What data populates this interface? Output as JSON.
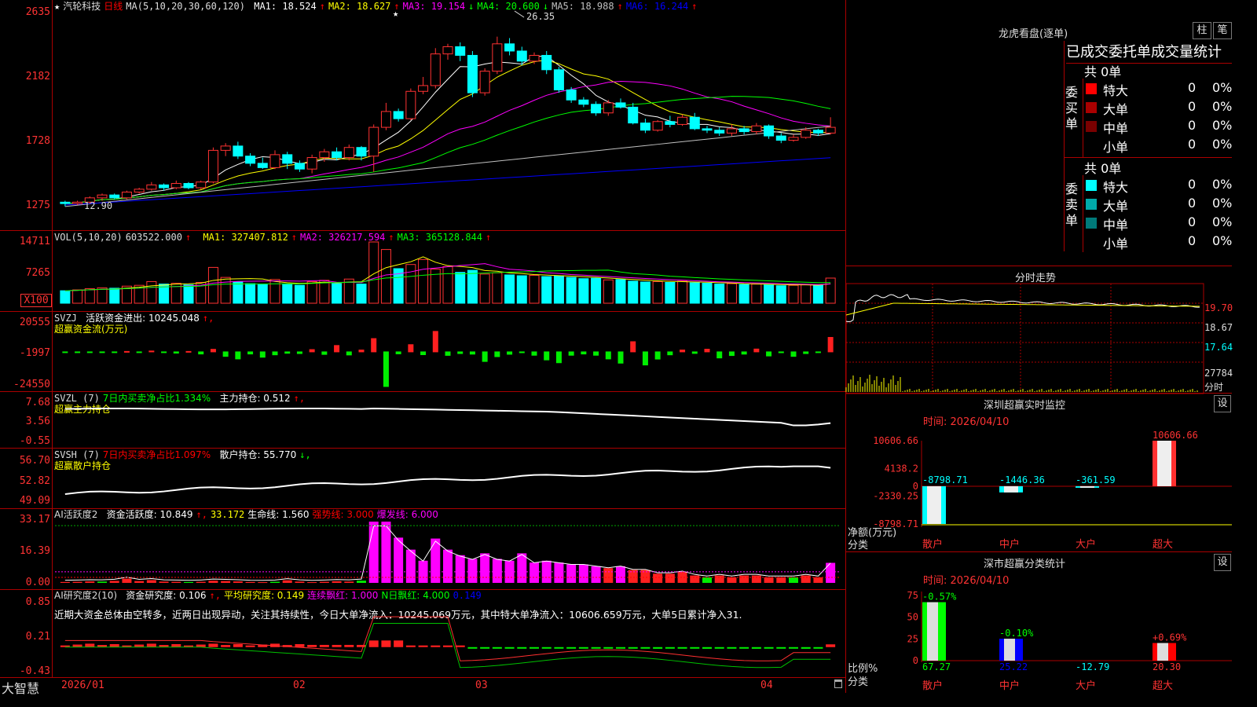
{
  "stock": {
    "star": "★",
    "name": "汽轮科技",
    "period": "日线"
  },
  "main": {
    "ma_header": "MA(5,10,20,30,60,120)",
    "ma_values": [
      {
        "label": "MA1: 18.524",
        "arrow": "↑",
        "color": "#ffffff"
      },
      {
        "label": "MA2: 18.627",
        "arrow": "↑",
        "color": "#ffff00"
      },
      {
        "label": "MA3: 19.154",
        "arrow": "↓",
        "color": "#ff00ff"
      },
      {
        "label": "MA4: 20.600",
        "arrow": "↓",
        "color": "#00ff00"
      },
      {
        "label": "MA5: 18.988",
        "arrow": "↑",
        "color": "#c0c0c0"
      },
      {
        "label": "MA6: 16.244",
        "arrow": "↑",
        "color": "#0000ff"
      }
    ],
    "y_labels": [
      "2635",
      "2182",
      "1728",
      "1275"
    ],
    "high_mark": "26.35",
    "low_mark": "12.90",
    "special_mark": "★"
  },
  "vol": {
    "header": "VOL(5,10,20)",
    "value": "603522.000",
    "arrow": "↑",
    "ma": [
      {
        "label": "MA1: 327407.812",
        "arrow": "↑",
        "color": "#ffff00"
      },
      {
        "label": "MA2: 326217.594",
        "arrow": "↑",
        "color": "#ff00ff"
      },
      {
        "label": "MA3: 365128.844",
        "arrow": "↑",
        "color": "#00ff00"
      }
    ],
    "y_labels": [
      "14711",
      "7265",
      "X100"
    ]
  },
  "svzj": {
    "title": "SVZJ",
    "label": "活跃资金进出: 10245.048",
    "arrow": "↑,",
    "sub": "超赢资金流(万元)",
    "y_labels": [
      "20555",
      "-1997",
      "-24550"
    ]
  },
  "svzl": {
    "title": "SVZL (7)",
    "green": "7日内买卖净占比1.334%",
    "label": "主力持仓: 0.512",
    "arrow": "↑,",
    "sub": "超赢主力持仓",
    "y_labels": [
      "7.68",
      "3.56",
      "-0.55"
    ]
  },
  "svsh": {
    "title": "SVSH (7)",
    "red": "7日内买卖净占比1.097%",
    "label": "散户持仓: 55.770",
    "arrow": "↓,",
    "sub": "超赢散户持仓",
    "y_labels": [
      "56.70",
      "52.82",
      "49.09"
    ]
  },
  "ai1": {
    "title": "AI活跃度2",
    "label": "资金活跃度: 10.849",
    "arrow": "↑,",
    "v2": "33.172",
    "v3": "生命线: 1.560",
    "v4": "强势线: 3.000",
    "v5": "爆发线: 6.000",
    "y_labels": [
      "33.17",
      "16.39",
      "0.00"
    ]
  },
  "ai2": {
    "title": "AI研究度2(10)",
    "label": "资金研究度: 0.106",
    "arrow": "↑,",
    "v2": "平均研究度: 0.149",
    "v3": "连续飘红: 1.000",
    "v4": "N日飘红: 4.000",
    "v5": "0.149",
    "comment": "近期大资金总体由空转多，近两日出现异动，关注其持续性，今日大单净流入：10245.069万元，其中特大单净流入：10606.659万元，大单5日累计净入31.",
    "y_labels": [
      "0.85",
      "0.21",
      "-0.43"
    ]
  },
  "xaxis": {
    "brand": "大智慧",
    "labels": [
      "2026/01",
      "02",
      "03",
      "04"
    ]
  },
  "lhb": {
    "title": "龙虎看盘(逐单)",
    "btn1": "柱",
    "btn2": "笔",
    "subtitle": "已成交委托单成交量统计",
    "buy": {
      "side": "委买单",
      "total": "共 0单",
      "rows": [
        {
          "name": "特大",
          "v": "0",
          "p": "0%",
          "color": "#ff0000"
        },
        {
          "name": "大单",
          "v": "0",
          "p": "0%",
          "color": "#aa0000"
        },
        {
          "name": "中单",
          "v": "0",
          "p": "0%",
          "color": "#7a0000"
        },
        {
          "name": "小单",
          "v": "0",
          "p": "0%",
          "color": "#000000"
        }
      ]
    },
    "sell": {
      "side": "委卖单",
      "total": "共 0单",
      "rows": [
        {
          "name": "特大",
          "v": "0",
          "p": "0%",
          "color": "#00ffff"
        },
        {
          "name": "大单",
          "v": "0",
          "p": "0%",
          "color": "#00aaaa"
        },
        {
          "name": "中单",
          "v": "0",
          "p": "0%",
          "color": "#007a7a"
        },
        {
          "name": "小单",
          "v": "0",
          "p": "0%",
          "color": "#000000"
        }
      ]
    }
  },
  "fenshi": {
    "title": "分时走势",
    "y_labels": [
      "19.70",
      "18.67",
      "17.64"
    ],
    "vol_label": "27784",
    "vol_unit": "分时"
  },
  "sz_monitor": {
    "title": "深圳超赢实时监控",
    "btn": "设",
    "time": "时间: 2026/04/10",
    "y_labels": [
      "10606.66",
      "4138.2",
      "0",
      "-2330.25",
      "-8798.71"
    ],
    "ylabel": "净额(万元)",
    "xlabel": "分类",
    "categories": [
      "散户",
      "中户",
      "大户",
      "超大"
    ],
    "values": [
      -8798.71,
      -1446.36,
      -361.59,
      10606.66
    ],
    "value_labels": [
      "-8798.71",
      "-1446.36",
      "-361.59",
      "10606.66"
    ]
  },
  "sz_class": {
    "title": "深市超赢分类统计",
    "btn": "设",
    "time": "时间: 2026/04/10",
    "y_labels": [
      "75",
      "50",
      "25",
      "0"
    ],
    "ylabel": "比例%",
    "xlabel": "分类",
    "categories": [
      "散户",
      "中户",
      "大户",
      "超大"
    ],
    "values": [
      67.27,
      25.22,
      -12.79,
      20.3
    ],
    "value_labels": [
      "67.27",
      "25.22",
      "-12.79",
      "20.30"
    ],
    "change_labels": [
      "-0.57%",
      "-0.10%",
      "",
      "+0.69%"
    ],
    "colors": [
      "#00ff00",
      "#0000ff",
      "#ffffff",
      "#ff0000"
    ]
  },
  "chart_data": [
    {
      "type": "candlestick",
      "title": "汽轮科技 日线",
      "ylim": [
        12.5,
        26.8
      ],
      "x": [
        "2026/01",
        "02",
        "03",
        "04"
      ],
      "candles": [
        [
          13.3,
          13.2,
          13.4,
          13.0
        ],
        [
          13.2,
          13.3,
          13.4,
          13.1
        ],
        [
          13.3,
          13.6,
          13.7,
          13.2
        ],
        [
          13.6,
          13.8,
          13.9,
          13.4
        ],
        [
          13.8,
          13.6,
          13.9,
          13.5
        ],
        [
          13.6,
          14.0,
          14.1,
          13.5
        ],
        [
          14.0,
          14.2,
          14.3,
          13.9
        ],
        [
          14.2,
          14.5,
          14.7,
          14.1
        ],
        [
          14.5,
          14.3,
          14.6,
          14.1
        ],
        [
          14.3,
          14.6,
          14.8,
          14.2
        ],
        [
          14.6,
          14.3,
          14.7,
          14.2
        ],
        [
          14.3,
          14.7,
          14.8,
          14.2
        ],
        [
          14.7,
          16.9,
          17.1,
          14.6
        ],
        [
          16.9,
          17.2,
          17.4,
          16.5
        ],
        [
          17.2,
          16.5,
          17.5,
          16.3
        ],
        [
          16.5,
          16.0,
          16.7,
          15.8
        ],
        [
          16.0,
          15.7,
          16.4,
          15.6
        ],
        [
          15.7,
          16.6,
          16.9,
          15.6
        ],
        [
          16.6,
          16.0,
          16.8,
          15.6
        ],
        [
          16.0,
          15.6,
          16.2,
          15.4
        ],
        [
          15.6,
          16.4,
          16.6,
          15.3
        ],
        [
          16.4,
          16.8,
          17.0,
          16.1
        ],
        [
          16.8,
          16.4,
          17.1,
          16.2
        ],
        [
          16.4,
          17.1,
          17.3,
          16.2
        ],
        [
          17.1,
          16.5,
          17.2,
          16.2
        ],
        [
          16.5,
          18.5,
          18.7,
          15.4
        ],
        [
          18.5,
          19.6,
          20.2,
          18.3
        ],
        [
          19.6,
          19.1,
          19.8,
          18.9
        ],
        [
          19.1,
          21.0,
          21.2,
          19.0
        ],
        [
          21.0,
          21.4,
          22.0,
          20.8
        ],
        [
          21.4,
          23.6,
          24.0,
          21.2
        ],
        [
          23.6,
          24.1,
          24.3,
          23.2
        ],
        [
          24.1,
          23.5,
          24.4,
          23.1
        ],
        [
          23.5,
          20.9,
          23.8,
          20.6
        ],
        [
          20.9,
          22.4,
          22.6,
          20.7
        ],
        [
          22.4,
          24.3,
          24.8,
          22.2
        ],
        [
          24.3,
          23.8,
          24.7,
          23.5
        ],
        [
          23.8,
          23.1,
          24.1,
          22.8
        ],
        [
          23.1,
          23.5,
          23.7,
          22.9
        ],
        [
          23.5,
          22.5,
          23.8,
          22.2
        ],
        [
          22.5,
          21.1,
          22.7,
          20.9
        ],
        [
          21.1,
          20.4,
          21.3,
          20.2
        ],
        [
          20.4,
          20.1,
          20.6,
          19.9
        ],
        [
          20.1,
          19.5,
          20.3,
          19.3
        ],
        [
          19.5,
          20.2,
          20.4,
          19.3
        ],
        [
          20.2,
          19.9,
          20.5,
          19.8
        ],
        [
          19.9,
          18.8,
          20.2,
          18.7
        ],
        [
          18.8,
          18.3,
          19.1,
          18.1
        ],
        [
          18.3,
          18.9,
          19.0,
          18.2
        ],
        [
          18.9,
          18.7,
          19.3,
          18.5
        ],
        [
          18.7,
          19.2,
          19.4,
          18.6
        ],
        [
          19.2,
          18.4,
          19.5,
          18.3
        ],
        [
          18.4,
          18.3,
          18.6,
          18.1
        ],
        [
          18.3,
          18.1,
          18.5,
          17.9
        ],
        [
          18.1,
          18.4,
          18.7,
          17.9
        ],
        [
          18.4,
          18.2,
          18.6,
          18.0
        ],
        [
          18.2,
          18.6,
          18.8,
          18.0
        ],
        [
          18.6,
          17.9,
          18.7,
          17.7
        ],
        [
          17.9,
          17.6,
          18.1,
          17.4
        ],
        [
          17.6,
          17.8,
          18.0,
          17.5
        ],
        [
          17.8,
          18.3,
          18.5,
          17.7
        ],
        [
          18.3,
          18.1,
          18.4,
          17.9
        ],
        [
          18.1,
          18.5,
          19.2,
          18.0
        ]
      ]
    },
    {
      "type": "bar",
      "title": "VOL(5,10,20)",
      "ylim": [
        0,
        14711
      ],
      "values": [
        3000,
        3200,
        3500,
        3700,
        3600,
        4100,
        4300,
        5200,
        4600,
        4800,
        4400,
        5000,
        8600,
        6200,
        5100,
        4700,
        4500,
        5700,
        4600,
        4300,
        5200,
        5500,
        4700,
        5800,
        4600,
        14711,
        12900,
        8300,
        9300,
        10500,
        8200,
        8800,
        7400,
        7900,
        7000,
        7300,
        6800,
        6600,
        6700,
        6400,
        6600,
        6200,
        5900,
        6000,
        5600,
        5700,
        5300,
        5100,
        5200,
        5000,
        5300,
        4900,
        4800,
        4600,
        4700,
        4500,
        4600,
        4400,
        4200,
        4300,
        4500,
        4300,
        6035
      ]
    },
    {
      "type": "bar",
      "title": "SVZJ 活跃资金进出",
      "ylim": [
        -24550,
        20555
      ],
      "values": [
        -500,
        -300,
        -400,
        -200,
        -300,
        300,
        -400,
        600,
        -300,
        -900,
        300,
        -1500,
        1800,
        -3200,
        -5000,
        -1500,
        -3800,
        -2100,
        -1000,
        -1200,
        1600,
        -1800,
        4500,
        -2200,
        1300,
        9400,
        -24550,
        -1400,
        5100,
        -2000,
        14500,
        -2500,
        -1200,
        -1600,
        -6800,
        -3400,
        -1700,
        -600,
        -2400,
        -5700,
        -7700,
        -2400,
        -1500,
        -2400,
        -5000,
        -8000,
        7200,
        -9300,
        -5100,
        -2100,
        1300,
        -1100,
        1900,
        -4300,
        -2600,
        -1600,
        2000,
        -2900,
        -600,
        -3200,
        -1200,
        -200,
        10245
      ]
    },
    {
      "type": "bar",
      "title": "深圳超赢实时监控",
      "categories": [
        "散户",
        "中户",
        "大户",
        "超大"
      ],
      "values": [
        -8798.71,
        -1446.36,
        -361.59,
        10606.66
      ],
      "ylim": [
        -8798.71,
        10606.66
      ]
    },
    {
      "type": "bar",
      "title": "深市超赢分类统计",
      "categories": [
        "散户",
        "中户",
        "大户",
        "超大"
      ],
      "values": [
        67.27,
        25.22,
        -12.79,
        20.3
      ],
      "ylim": [
        0,
        75
      ]
    }
  ]
}
